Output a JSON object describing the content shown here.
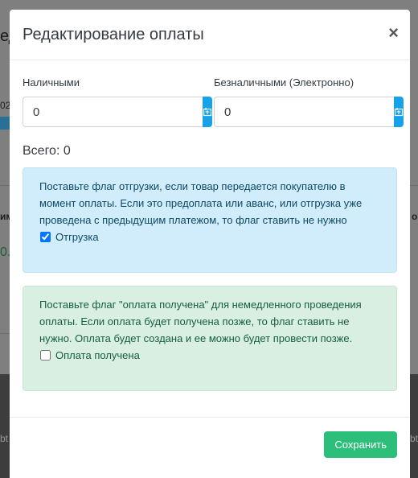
{
  "background": {
    "fragments": [
      "ед",
      "02",
      "им",
      "о",
      "0.",
      "bt",
      "bt"
    ]
  },
  "modal": {
    "title": "Редактирование оплаты",
    "close_glyph": "×",
    "cash": {
      "label": "Наличными",
      "value": "0"
    },
    "cashless": {
      "label": "Безналичными (Электронно)",
      "value": "0"
    },
    "total_label": "Всего: 0",
    "shipment_alert": {
      "text": "Поставьте флаг отгрузки, если товар передается покупателю в момент оплаты. Если это предоплата или аванс, или отгрузка уже проведена с предыдущим платежом, то флаг ставить не нужно",
      "checkbox_label": "Отгрузка",
      "checked": true
    },
    "payment_alert": {
      "text": "Поставьте флаг \"оплата получена\" для немедленного проведения оплаты. Если оплата будет получена позже, то флаг ставить не нужно. Оплата будет создана и ее можно будет провести позже.",
      "checkbox_label": "Оплата получена",
      "checked": false
    },
    "save_label": "Сохранить"
  },
  "colors": {
    "accent": "#17a2e8",
    "save": "#2bbf7a",
    "info_bg": "#d1ecfb",
    "success_bg": "#d8efe2"
  },
  "icons": {
    "input_addon": "calculator-icon",
    "close": "close-icon"
  }
}
